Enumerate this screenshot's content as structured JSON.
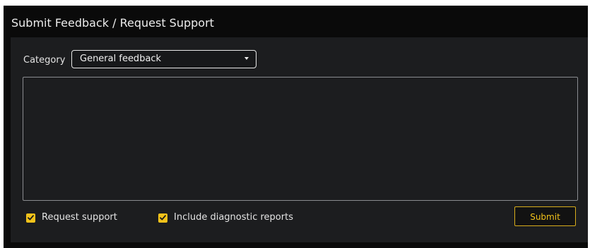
{
  "dialog": {
    "title": "Submit Feedback / Request Support"
  },
  "form": {
    "category_label": "Category",
    "category_selected": "General feedback",
    "message_value": "",
    "request_support": {
      "label": "Request support",
      "checked": true
    },
    "include_diagnostics": {
      "label": "Include diagnostic reports",
      "checked": true
    },
    "submit_label": "Submit"
  },
  "colors": {
    "accent": "#f2c21a",
    "background": "#0a0a0a",
    "panel": "#1c1d1f",
    "text": "#e4e4e4"
  },
  "icons": {
    "dropdown": "caret-down-icon",
    "checkbox": "checkmark-icon"
  }
}
